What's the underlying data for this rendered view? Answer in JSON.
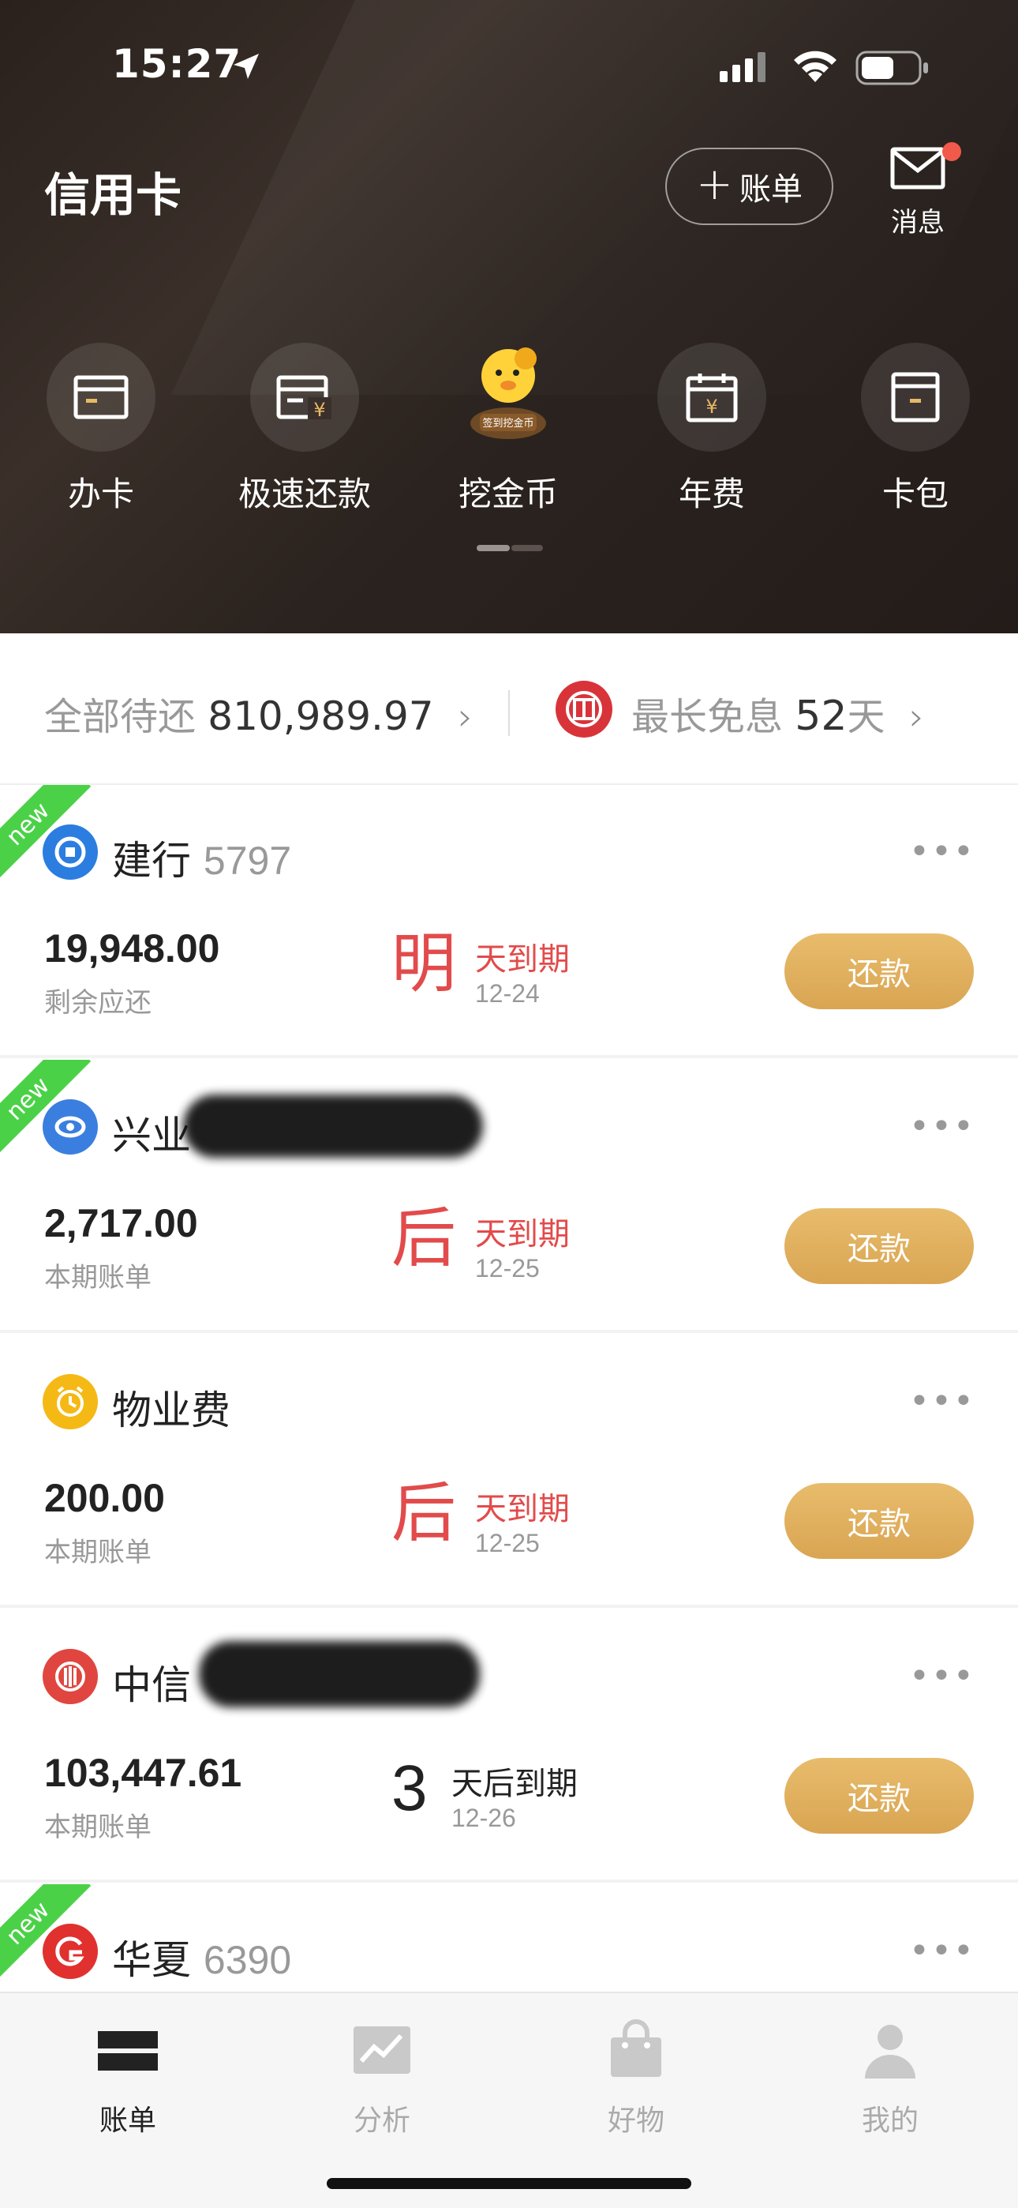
{
  "status": {
    "time": "15:27"
  },
  "header": {
    "title": "信用卡",
    "add_bill_label": "账单",
    "messages_label": "消息",
    "quick_actions": [
      {
        "label": "办卡",
        "icon": "card-icon"
      },
      {
        "label": "极速还款",
        "icon": "fast-repay-icon"
      },
      {
        "label": "挖金币",
        "icon": "gold-mascot-icon",
        "badge": "签到挖金币"
      },
      {
        "label": "年费",
        "icon": "annual-fee-calendar-icon"
      },
      {
        "label": "卡包",
        "icon": "card-wallet-icon"
      }
    ]
  },
  "summary": {
    "total_label": "全部待还",
    "total_value": "810,989.97",
    "free_label": "最长免息",
    "free_days": "52",
    "free_unit": "天"
  },
  "cards": [
    {
      "new": "new",
      "bank": "建行",
      "tail": "5797",
      "amount": "19,948.00",
      "amount_label": "剩余应还",
      "due_big": "明",
      "due_text": "天到期",
      "due_date": "12-24",
      "pay_label": "还款",
      "logo_color": "#2b7de0"
    },
    {
      "new": "new",
      "bank": "兴业",
      "tail": "",
      "amount": "2,717.00",
      "amount_label": "本期账单",
      "due_big": "后",
      "due_text": "天到期",
      "due_date": "12-25",
      "pay_label": "还款",
      "logo_color": "#3a7fe0"
    },
    {
      "new": "",
      "bank": "物业费",
      "tail": "",
      "amount": "200.00",
      "amount_label": "本期账单",
      "due_big": "后",
      "due_text": "天到期",
      "due_date": "12-25",
      "pay_label": "还款",
      "logo_color": "#f5b915"
    },
    {
      "new": "",
      "bank": "中信",
      "tail": "",
      "amount": "103,447.61",
      "amount_label": "本期账单",
      "due_big": "3",
      "due_text": "天后到期",
      "due_date": "12-26",
      "pay_label": "还款",
      "logo_color": "#e0463f"
    },
    {
      "new": "new",
      "bank": "华夏",
      "tail": "6390",
      "logo_color": "#e0312e"
    }
  ],
  "tabbar": [
    {
      "label": "账单",
      "icon": "bill-icon",
      "active": true
    },
    {
      "label": "分析",
      "icon": "analysis-icon",
      "active": false
    },
    {
      "label": "好物",
      "icon": "shopping-bag-icon",
      "active": false
    },
    {
      "label": "我的",
      "icon": "profile-icon",
      "active": false
    }
  ],
  "colors": {
    "accent_gold": "#dca858",
    "due_red": "#e24b4b",
    "new_green": "#4bd147",
    "header_bg": "#2b231f"
  }
}
